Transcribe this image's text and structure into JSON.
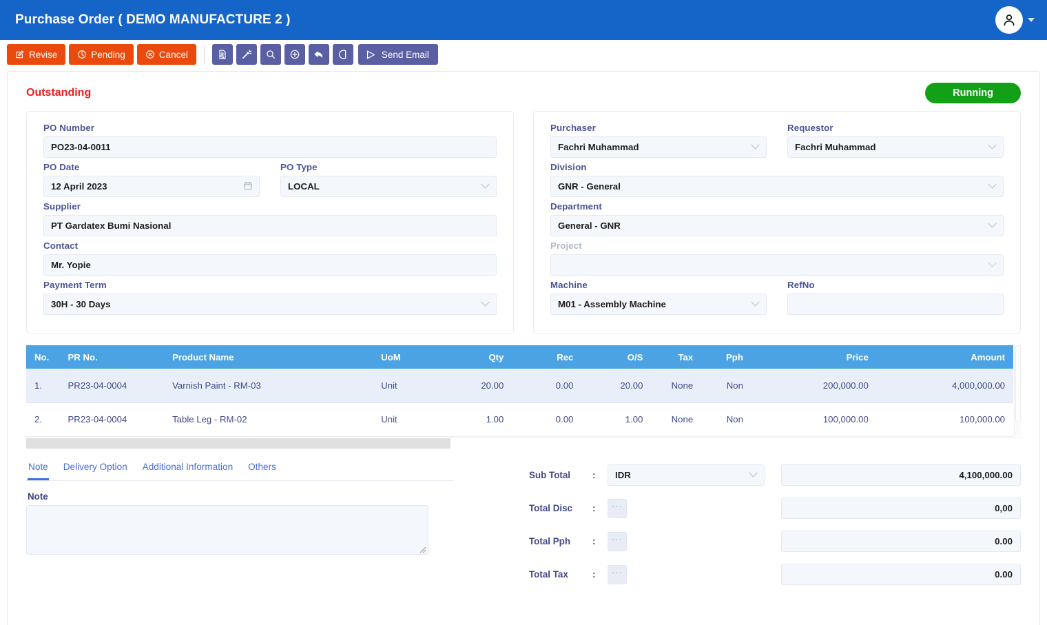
{
  "appbar": {
    "title": "Purchase Order ( DEMO MANUFACTURE 2 )",
    "avatar_icon": "user-icon",
    "caret_icon": "caret-down-icon",
    "bg_color": "#1565c8"
  },
  "toolbar": {
    "actions": [
      {
        "label": "Revise",
        "icon": "edit-square-icon"
      },
      {
        "label": "Pending",
        "icon": "clock-icon"
      },
      {
        "label": "Cancel",
        "icon": "circle-x-icon"
      }
    ],
    "icon_buttons": [
      {
        "name": "document-search-icon"
      },
      {
        "name": "magic-wand-icon"
      },
      {
        "name": "search-icon"
      },
      {
        "name": "plus-circle-icon"
      },
      {
        "name": "undo-arrow-icon"
      },
      {
        "name": "history-clock-icon"
      }
    ],
    "send_email": {
      "label": "Send Email",
      "icon": "paper-plane-icon"
    },
    "action_color": "#ea4a0d",
    "icon_color": "#5a5fa3"
  },
  "status": {
    "outstanding_label": "Outstanding",
    "outstanding_color": "#f01c1c",
    "running_badge": "Running",
    "running_color": "#12a116"
  },
  "form_left": {
    "po_number": {
      "label": "PO Number",
      "value": "PO23-04-0011"
    },
    "po_date": {
      "label": "PO Date",
      "value": "12 April 2023",
      "icon": "calendar-icon"
    },
    "po_type": {
      "label": "PO Type",
      "value": "LOCAL"
    },
    "supplier": {
      "label": "Supplier",
      "value": "PT Gardatex Bumi Nasional"
    },
    "contact": {
      "label": "Contact",
      "value": "Mr. Yopie"
    },
    "payment_term": {
      "label": "Payment Term",
      "value": "30H - 30 Days"
    }
  },
  "form_right": {
    "purchaser": {
      "label": "Purchaser",
      "value": "Fachri Muhammad"
    },
    "requestor": {
      "label": "Requestor",
      "value": "Fachri Muhammad"
    },
    "division": {
      "label": "Division",
      "value": "GNR - General"
    },
    "department": {
      "label": "Department",
      "value": "General - GNR"
    },
    "project": {
      "label": "Project",
      "value": "",
      "disabled": true
    },
    "machine": {
      "label": "Machine",
      "value": "M01 - Assembly Machine"
    },
    "refno": {
      "label": "RefNo",
      "value": ""
    }
  },
  "table": {
    "columns": [
      "No.",
      "PR No.",
      "Product Name",
      "UoM",
      "Qty",
      "Rec",
      "O/S",
      "Tax",
      "Pph",
      "Price",
      "Amount"
    ],
    "rows": [
      {
        "no": "1.",
        "pr_no": "PR23-04-0004",
        "product_name": "Varnish Paint - RM-03",
        "uom": "Unit",
        "qty": "20.00",
        "rec": "0.00",
        "os": "20.00",
        "tax": "None",
        "pph": "Non",
        "price": "200,000.00",
        "amount": "4,000,000.00"
      },
      {
        "no": "2.",
        "pr_no": "PR23-04-0004",
        "product_name": "Table Leg - RM-02",
        "uom": "Unit",
        "qty": "1.00",
        "rec": "0.00",
        "os": "1.00",
        "tax": "None",
        "pph": "Non",
        "price": "100,000.00",
        "amount": "100,000.00"
      }
    ],
    "header_color": "#4ba3e3"
  },
  "tabs": {
    "items": [
      "Note",
      "Delivery Option",
      "Additional Information",
      "Others"
    ],
    "active": "Note"
  },
  "note": {
    "label": "Note",
    "value": "",
    "placeholder": ""
  },
  "totals": [
    {
      "label": "Sub Total",
      "colon": ":",
      "currency": "IDR",
      "value": "4,100,000.00",
      "control": "select"
    },
    {
      "label": "Total Disc",
      "colon": ":",
      "dots": "···",
      "value": "0,00",
      "control": "dots"
    },
    {
      "label": "Total Pph",
      "colon": ":",
      "dots": "···",
      "value": "0.00",
      "control": "dots"
    },
    {
      "label": "Total Tax",
      "colon": ":",
      "dots": "···",
      "value": "0.00",
      "control": "dots"
    }
  ]
}
